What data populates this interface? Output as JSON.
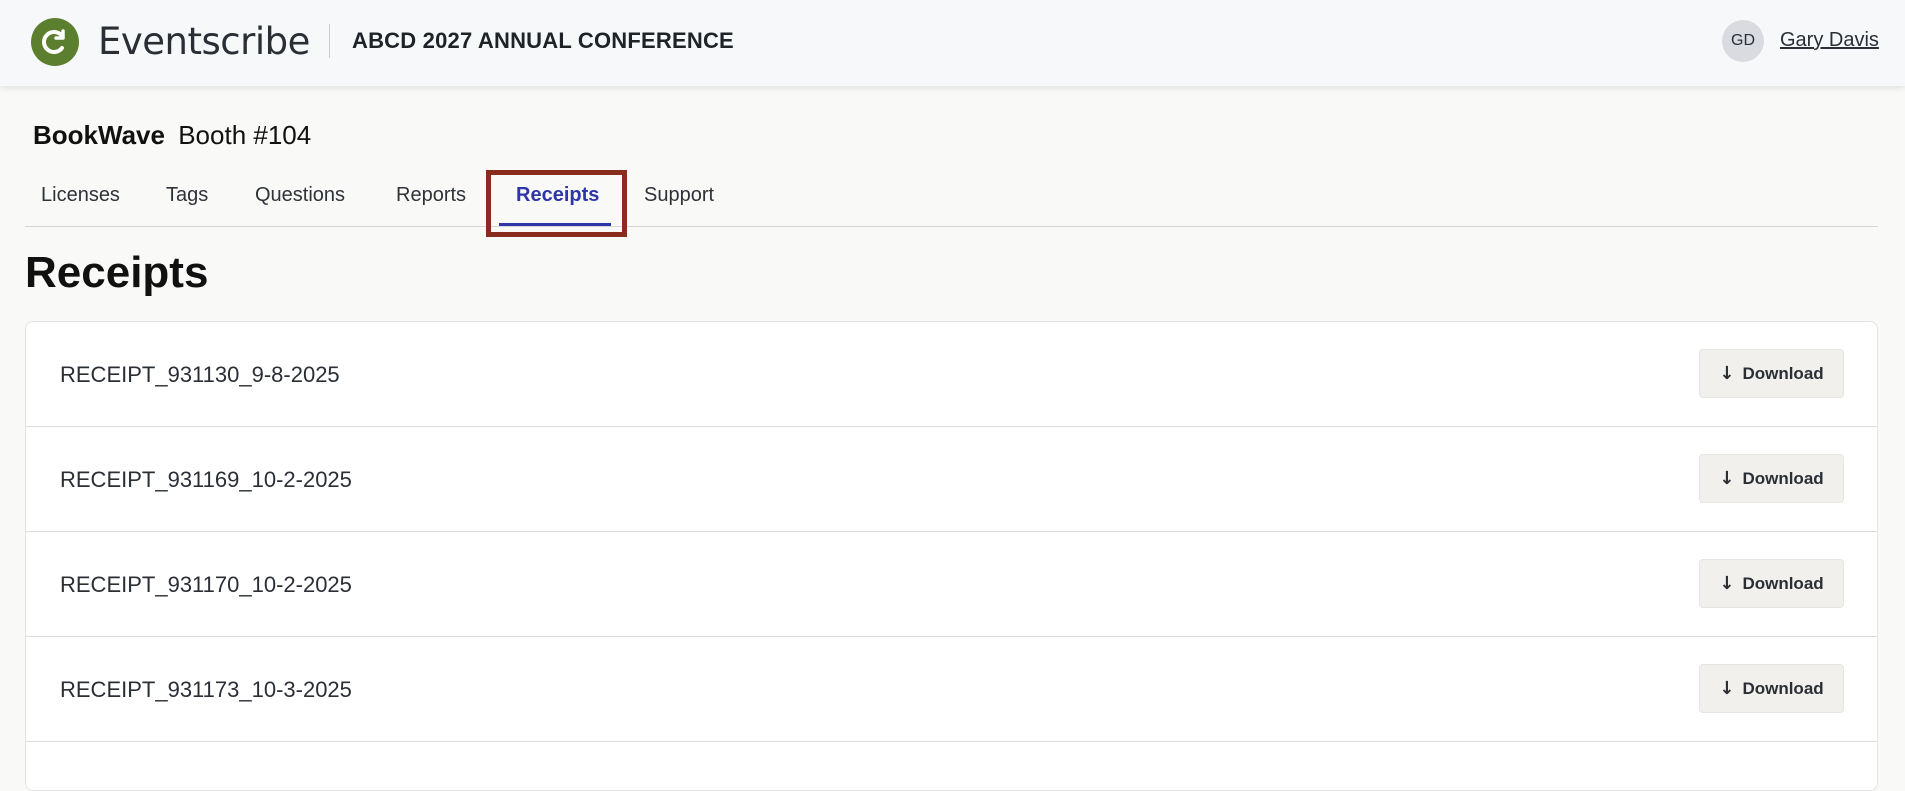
{
  "header": {
    "logo_icon": "refresh-c-icon",
    "brand": "Eventscribe",
    "event_title": "ABCD 2027 ANNUAL CONFERENCE",
    "user": {
      "initials": "GD",
      "name": "Gary Davis"
    }
  },
  "booth": {
    "company": "BookWave",
    "number": "Booth #104"
  },
  "tabs": [
    {
      "label": "Licenses",
      "active": false
    },
    {
      "label": "Tags",
      "active": false
    },
    {
      "label": "Questions",
      "active": false
    },
    {
      "label": "Reports",
      "active": false
    },
    {
      "label": "Receipts",
      "active": true
    },
    {
      "label": "Support",
      "active": false
    }
  ],
  "page_title": "Receipts",
  "receipts": [
    {
      "name": "RECEIPT_931130_9-8-2025",
      "button": "Download"
    },
    {
      "name": "RECEIPT_931169_10-2-2025",
      "button": "Download"
    },
    {
      "name": "RECEIPT_931170_10-2-2025",
      "button": "Download"
    },
    {
      "name": "RECEIPT_931173_10-3-2025",
      "button": "Download"
    }
  ],
  "colors": {
    "brand_green": "#5b7f2e",
    "active_tab": "#2e36a8",
    "highlight_box": "#8a2c1d"
  }
}
